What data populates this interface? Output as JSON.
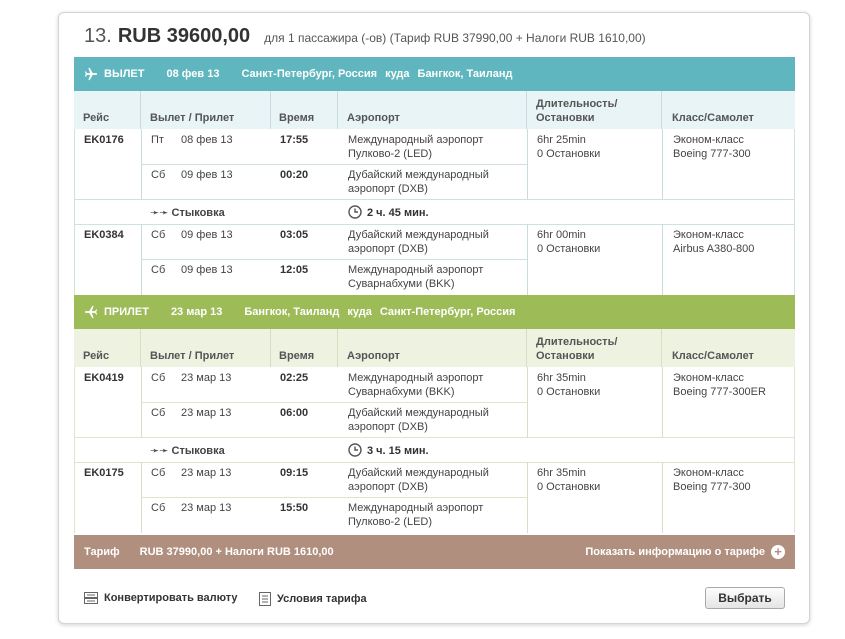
{
  "header": {
    "number": "13.",
    "price": "RUB 39600,00",
    "note": "для 1 пассажира (-ов) (Тариф RUB 37990,00 + Налоги RUB 1610,00)"
  },
  "columns": {
    "flight": "Рейс",
    "dep_arr": "Вылет / Прилет",
    "time": "Время",
    "airport": "Аэропорт",
    "duration_1": "Длительность/",
    "duration_2": "Остановки",
    "class": "Класс/Самолет"
  },
  "outbound": {
    "label": "ВЫЛЕТ",
    "date": "08 фев 13",
    "from": "Санкт-Петербург, Россия",
    "to_word": "куда",
    "to": "Бангкок, Таиланд",
    "legs": [
      {
        "flight": "EK0176",
        "rows": [
          {
            "day": "Пт",
            "date": "08 фев 13",
            "time": "17:55",
            "airport_1": "Международный аэропорт",
            "airport_2": "Пулково-2 (LED)"
          },
          {
            "day": "Сб",
            "date": "09 фев 13",
            "time": "00:20",
            "airport_1": "Дубайский международный",
            "airport_2": "аэропорт (DXB)"
          }
        ],
        "duration": "6hr 25min",
        "stops": "0 Остановки",
        "class": "Эконом-класс",
        "aircraft": "Boeing 777-300"
      },
      {
        "flight": "EK0384",
        "rows": [
          {
            "day": "Сб",
            "date": "09 фев 13",
            "time": "03:05",
            "airport_1": "Дубайский международный",
            "airport_2": "аэропорт (DXB)"
          },
          {
            "day": "Сб",
            "date": "09 фев 13",
            "time": "12:05",
            "airport_1": "Международный аэропорт",
            "airport_2": "Суварнабхуми (BKK)"
          }
        ],
        "duration": "6hr 00min",
        "stops": "0 Остановки",
        "class": "Эконом-класс",
        "aircraft": "Airbus A380-800"
      }
    ],
    "connection_label": "Стыковка",
    "connection_time": "2 ч. 45 мин."
  },
  "inbound": {
    "label": "ПРИЛЕТ",
    "date": "23 мар 13",
    "from": "Бангкок, Таиланд",
    "to_word": "куда",
    "to": "Санкт-Петербург, Россия",
    "legs": [
      {
        "flight": "EK0419",
        "rows": [
          {
            "day": "Сб",
            "date": "23 мар 13",
            "time": "02:25",
            "airport_1": "Международный аэропорт",
            "airport_2": "Суварнабхуми (BKK)"
          },
          {
            "day": "Сб",
            "date": "23 мар 13",
            "time": "06:00",
            "airport_1": "Дубайский международный",
            "airport_2": "аэропорт (DXB)"
          }
        ],
        "duration": "6hr 35min",
        "stops": "0 Остановки",
        "class": "Эконом-класс",
        "aircraft": "Boeing 777-300ER"
      },
      {
        "flight": "EK0175",
        "rows": [
          {
            "day": "Сб",
            "date": "23 мар 13",
            "time": "09:15",
            "airport_1": "Дубайский международный",
            "airport_2": "аэропорт (DXB)"
          },
          {
            "day": "Сб",
            "date": "23 мар 13",
            "time": "15:50",
            "airport_1": "Международный аэропорт",
            "airport_2": "Пулково-2 (LED)"
          }
        ],
        "duration": "6hr 35min",
        "stops": "0 Остановки",
        "class": "Эконом-класс",
        "aircraft": "Boeing 777-300"
      }
    ],
    "connection_label": "Стыковка",
    "connection_time": "3 ч. 15 мин."
  },
  "fare_bar": {
    "label": "Тариф",
    "value": "RUB 37990,00 + Налоги RUB 1610,00",
    "more": "Показать информацию о тарифе"
  },
  "footer": {
    "convert": "Конвертировать валюту",
    "conditions": "Условия тарифа",
    "select": "Выбрать"
  },
  "colors": {
    "departure_band": "#5fb6be",
    "return_band": "#9dbb57",
    "fare_band": "#b08f7f"
  },
  "icons": {
    "plane": "plane-icon",
    "clock": "clock-icon",
    "connection": "double-chevron-icon",
    "plus": "plus-circle-icon",
    "currency": "currency-icon",
    "document": "document-icon"
  }
}
